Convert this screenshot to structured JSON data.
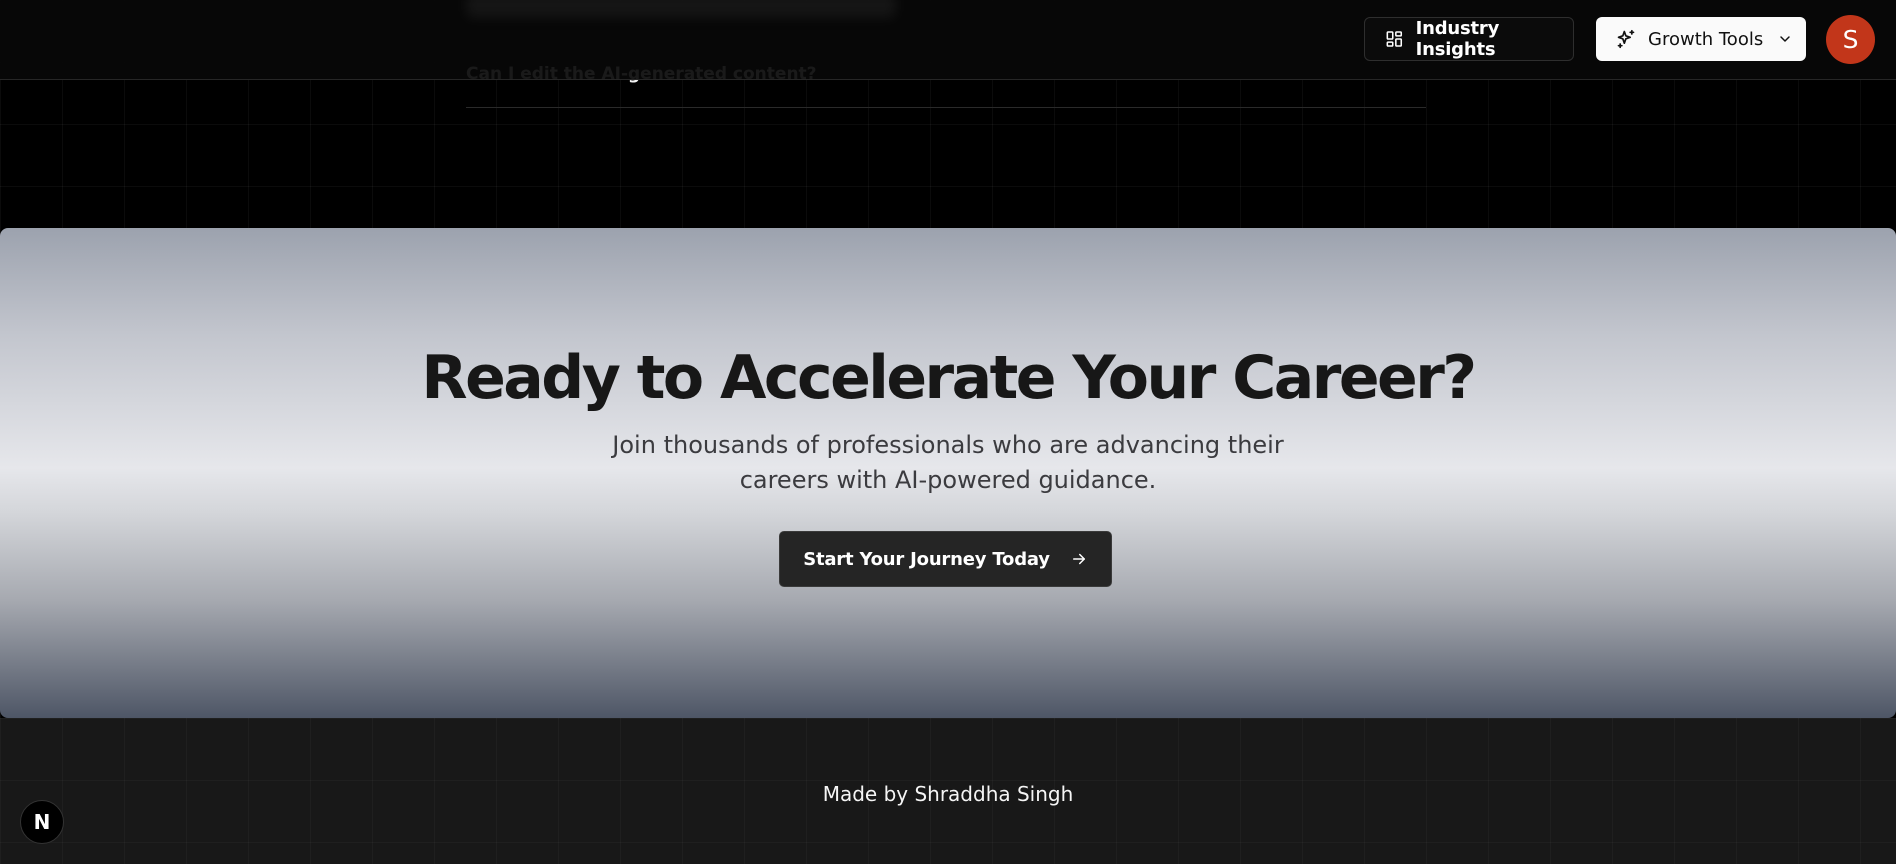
{
  "header": {
    "industry_insights_label": "Industry Insights",
    "growth_tools_label": "Growth Tools",
    "avatar_initial": "S",
    "avatar_color": "#c2361a"
  },
  "faq": {
    "last_question": "Can I edit the AI-generated content?"
  },
  "cta": {
    "title": "Ready to Accelerate Your Career?",
    "subtitle": "Join thousands of professionals who are advancing their careers with AI-powered guidance.",
    "button_label": "Start Your Journey Today"
  },
  "footer": {
    "credit": "Made by Shraddha Singh"
  },
  "dev_badge": {
    "letter": "N"
  },
  "icons": {
    "industry_insights": "layout-dashboard-icon",
    "growth_tools": "sparkles-icon",
    "dropdown": "chevron-down-icon",
    "cta_arrow": "arrow-right-icon"
  }
}
